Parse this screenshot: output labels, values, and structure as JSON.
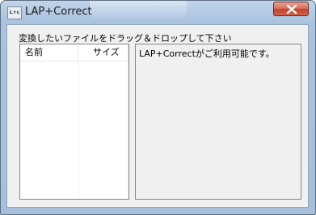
{
  "window": {
    "title": "LAP+Correct",
    "icon_label": "L+c",
    "icon": "app-icon",
    "close_icon": "close-icon"
  },
  "main": {
    "instruction": "変換したいファイルをドラッグ＆ドロップして下さい",
    "file_list": {
      "columns": [
        "名前",
        "サイズ"
      ],
      "rows": []
    },
    "message": "LAP+Correctがご利用可能です。"
  }
}
